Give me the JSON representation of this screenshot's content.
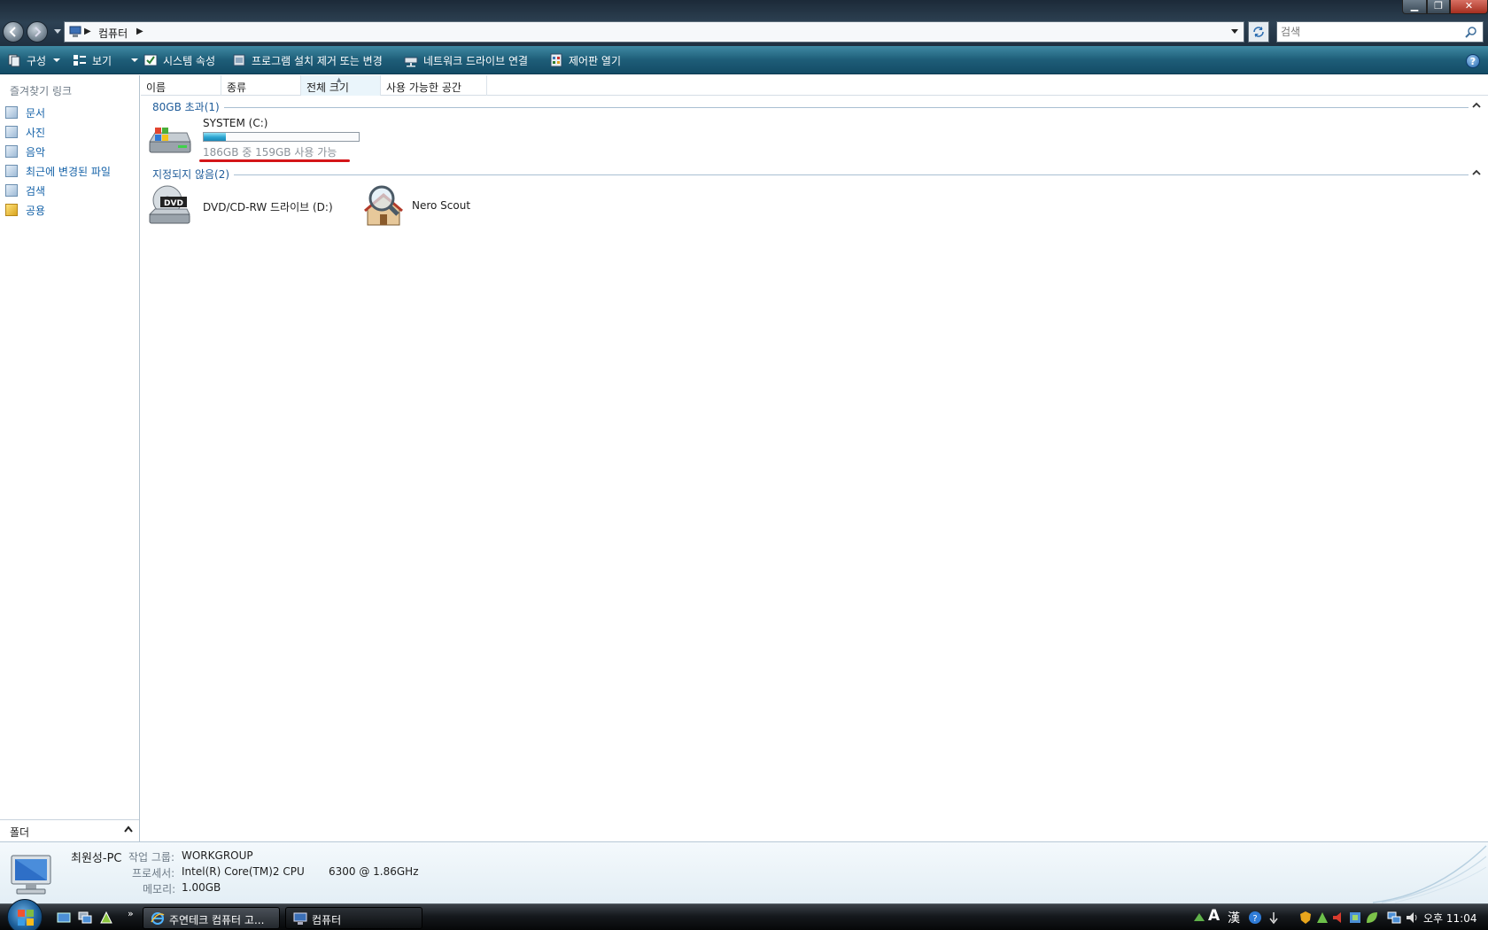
{
  "address": {
    "crumb": "컴퓨터",
    "search_placeholder": "검색"
  },
  "toolbar": {
    "organize": "구성",
    "views": "보기",
    "system_properties": "시스템 속성",
    "uninstall": "프로그램 설치 제거 또는 변경",
    "map_drive": "네트워크 드라이브 연결",
    "control_panel": "제어판 열기"
  },
  "sidebar": {
    "title": "즐겨찾기 링크",
    "items": [
      {
        "label": "문서",
        "icon": "documents-icon"
      },
      {
        "label": "사진",
        "icon": "pictures-icon"
      },
      {
        "label": "음악",
        "icon": "music-icon"
      },
      {
        "label": "최근에 변경된 파일",
        "icon": "recent-icon"
      },
      {
        "label": "검색",
        "icon": "searches-icon"
      },
      {
        "label": "공용",
        "icon": "public-icon"
      }
    ],
    "folders": "폴더"
  },
  "columns": [
    "이름",
    "종류",
    "전체 크기",
    "사용 가능한 공간"
  ],
  "groups": {
    "large": {
      "title": "80GB 초과(1)"
    },
    "unspecified": {
      "title": "지정되지 않음(2)"
    }
  },
  "drives": {
    "system": {
      "name": "SYSTEM (C:)",
      "free_text": "186GB 중 159GB 사용 가능",
      "used_fraction": 0.145
    },
    "dvd": {
      "name": "DVD/CD-RW 드라이브 (D:)"
    },
    "nero": {
      "name": "Nero Scout"
    }
  },
  "details": {
    "pc_name": "최원성-PC",
    "workgroup_label": "작업 그룹:",
    "workgroup": "WORKGROUP",
    "processor_label": "프로세서:",
    "processor": "Intel(R) Core(TM)2 CPU",
    "processor_speed": "6300  @ 1.86GHz",
    "memory_label": "메모리:",
    "memory": "1.00GB"
  },
  "taskbar": {
    "tasks": [
      {
        "label": "주연테크 컴퓨터 고...",
        "icon": "ie-icon"
      },
      {
        "label": "컴퓨터",
        "icon": "computer-icon"
      }
    ],
    "clock": "오후 11:04",
    "ime_mode": "A",
    "ime_hanja": "漢"
  },
  "colors": {
    "accent": "#1e5b99",
    "toolbar": "#1e5d78",
    "highlight": "#d41518"
  }
}
